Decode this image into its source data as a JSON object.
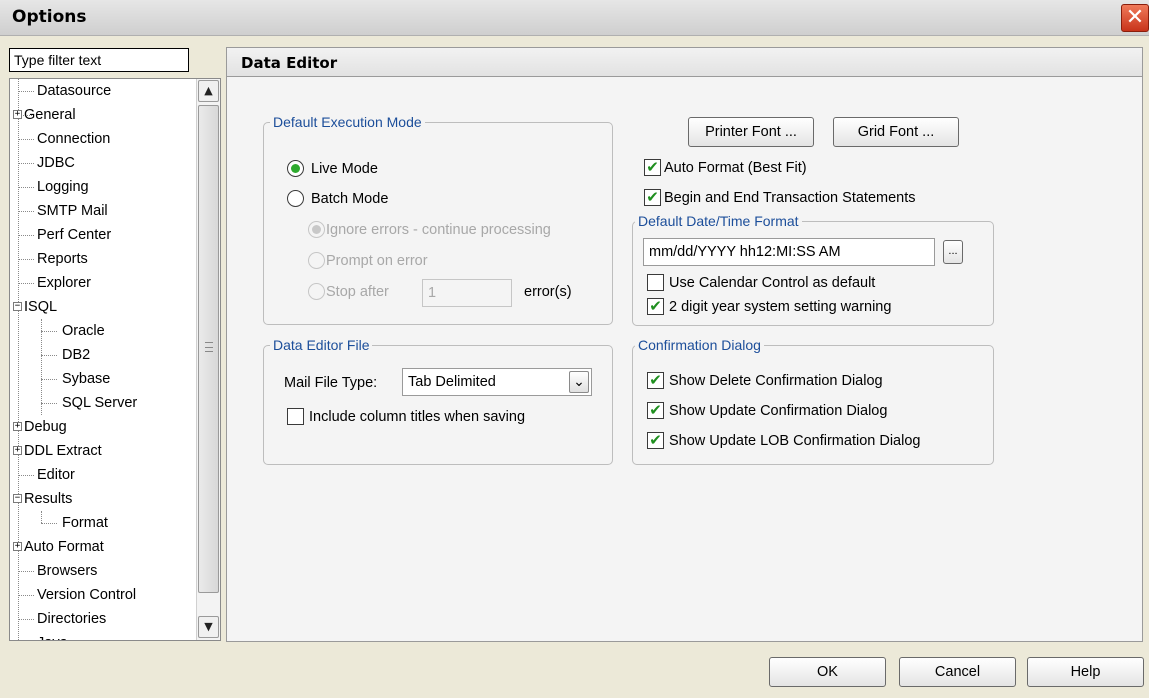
{
  "window": {
    "title": "Options",
    "close_glyph": "✕"
  },
  "filter": {
    "placeholder": "Type filter text",
    "value": "Type filter text"
  },
  "tree": {
    "items": [
      {
        "label": "Datasource",
        "expander": ""
      },
      {
        "label": "General",
        "expander": "+"
      },
      {
        "label": "Connection",
        "expander": ""
      },
      {
        "label": "JDBC",
        "expander": ""
      },
      {
        "label": "Logging",
        "expander": ""
      },
      {
        "label": "SMTP Mail",
        "expander": ""
      },
      {
        "label": "Perf Center",
        "expander": ""
      },
      {
        "label": "Reports",
        "expander": ""
      },
      {
        "label": "Explorer",
        "expander": ""
      },
      {
        "label": "ISQL",
        "expander": "−"
      },
      {
        "label": "Oracle",
        "expander": ""
      },
      {
        "label": "DB2",
        "expander": ""
      },
      {
        "label": "Sybase",
        "expander": ""
      },
      {
        "label": "SQL Server",
        "expander": ""
      },
      {
        "label": "Debug",
        "expander": "+"
      },
      {
        "label": "DDL Extract",
        "expander": "+"
      },
      {
        "label": "Editor",
        "expander": ""
      },
      {
        "label": "Results",
        "expander": "−"
      },
      {
        "label": "Format",
        "expander": ""
      },
      {
        "label": "Auto Format",
        "expander": "+"
      },
      {
        "label": "Browsers",
        "expander": ""
      },
      {
        "label": "Version Control",
        "expander": ""
      },
      {
        "label": "Directories",
        "expander": ""
      },
      {
        "label": "Java",
        "expander": ""
      }
    ],
    "scroll_up_glyph": "▲",
    "scroll_down_glyph": "▼"
  },
  "content": {
    "title": "Data Editor",
    "execution_mode": {
      "title": "Default Execution Mode",
      "live_mode": "Live Mode",
      "batch_mode": "Batch Mode",
      "ignore_errors": "Ignore errors - continue processing",
      "prompt_on_error": "Prompt on error",
      "stop_after": "Stop after",
      "stop_after_value": "1",
      "errors_suffix": "error(s)"
    },
    "data_editor_file": {
      "title": "Data Editor File",
      "mail_file_type_label": "Mail File Type:",
      "mail_file_type_value": "Tab Delimited",
      "dropdown_glyph": "⌄",
      "include_titles": "Include column titles when saving"
    },
    "fonts": {
      "printer_font": "Printer Font ...",
      "grid_font": "Grid Font ..."
    },
    "auto_format": "Auto Format (Best Fit)",
    "begin_end_transaction": "Begin and End Transaction Statements",
    "datetime": {
      "title": "Default Date/Time Format",
      "format_value": "mm/dd/YYYY hh12:MI:SS AM",
      "browse_glyph": "...",
      "use_calendar": "Use Calendar Control as default",
      "two_digit_year": "2 digit year system setting warning"
    },
    "confirmation": {
      "title": "Confirmation Dialog",
      "show_delete": "Show Delete Confirmation Dialog",
      "show_update": "Show Update Confirmation Dialog",
      "show_update_lob": "Show Update LOB Confirmation Dialog"
    },
    "check_glyph": "✔"
  },
  "buttons": {
    "ok": "OK",
    "cancel": "Cancel",
    "help": "Help"
  },
  "colors": {
    "group_title": "#1c4e9a",
    "check": "#1f8f1f",
    "radio_selected": "#2eaa2e",
    "close_button": "#c8331a"
  }
}
